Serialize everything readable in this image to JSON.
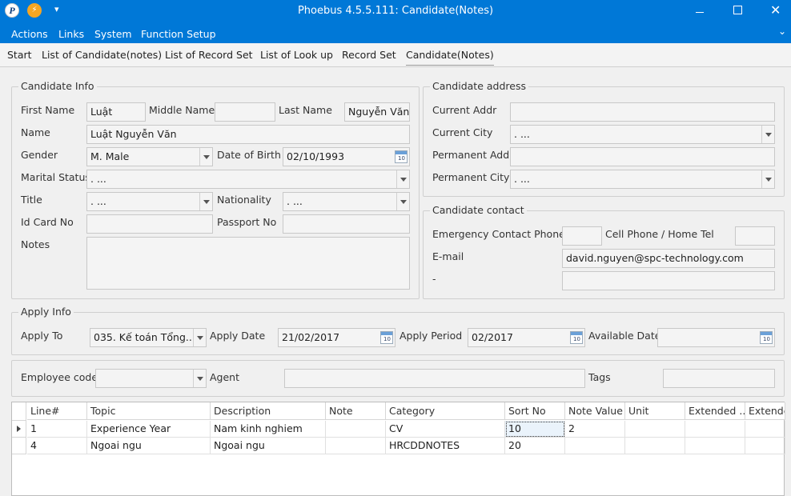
{
  "window": {
    "title": "Phoebus 4.5.5.111: Candidate(Notes)",
    "quick_access": "▾"
  },
  "menu": [
    "Actions",
    "Links",
    "System",
    "Function Setup"
  ],
  "tabs": [
    "Start",
    "List of Candidate(notes)",
    "List of Record Set",
    "List of Look up",
    "Record Set",
    "Candidate(Notes)"
  ],
  "candidate_info": {
    "title": "Candidate Info",
    "first_name_label": "First Name",
    "first_name": "Luật",
    "middle_name_label": "Middle Name",
    "middle_name": "",
    "last_name_label": "Last Name",
    "last_name": "Nguyễn Văn",
    "name_label": "Name",
    "name": "Luật  Nguyễn Văn",
    "gender_label": "Gender",
    "gender": "M. Male",
    "dob_label": "Date of Birth",
    "dob": "02/10/1993",
    "marital_label": "Marital Status",
    "marital": ". ...",
    "title_label": "Title",
    "title_value": ". ...",
    "nationality_label": "Nationality",
    "nationality": ". ...",
    "id_card_label": "Id Card No",
    "id_card": "",
    "passport_label": "Passport No",
    "passport": "",
    "notes_label": "Notes",
    "notes": ""
  },
  "candidate_address": {
    "title": "Candidate address",
    "current_addr_label": "Current Addr",
    "current_addr": "",
    "current_city_label": "Current City",
    "current_city": ". ...",
    "permanent_addr_label": "Permanent Addr",
    "permanent_addr": "",
    "permanent_city_label": "Permanent City",
    "permanent_city": ". ..."
  },
  "candidate_contact": {
    "title": "Candidate contact",
    "emergency_label": "Emergency Contact Phone",
    "emergency": "",
    "cell_label": "Cell Phone / Home Tel",
    "cell": "",
    "email_label": "E-mail",
    "email": "david.nguyen@spc-technology.com",
    "dash_label": "-",
    "dash_value": ""
  },
  "apply_info": {
    "title": "Apply Info",
    "apply_to_label": "Apply To",
    "apply_to": "035. Kế toán Tổng...",
    "apply_date_label": "Apply Date",
    "apply_date": "21/02/2017",
    "apply_period_label": "Apply Period",
    "apply_period": "02/2017",
    "available_label": "Available Date",
    "available": ""
  },
  "employee": {
    "code_label": "Employee code",
    "code": "",
    "agent_label": "Agent",
    "agent": "",
    "tags_label": "Tags",
    "tags": ""
  },
  "grid": {
    "columns": [
      "Line#",
      "Topic",
      "Description",
      "Note",
      "Category",
      "Sort No",
      "Note Value",
      "Unit",
      "Extended ...",
      "Extende"
    ],
    "rows": [
      [
        "1",
        "Experience Year",
        "Nam kinh nghiem",
        "",
        "CV",
        "10",
        "2",
        "",
        "",
        ""
      ],
      [
        "4",
        "Ngoai ngu",
        "Ngoai ngu",
        "",
        "HRCDDNOTES",
        "20",
        "",
        "",
        "",
        ""
      ]
    ]
  }
}
